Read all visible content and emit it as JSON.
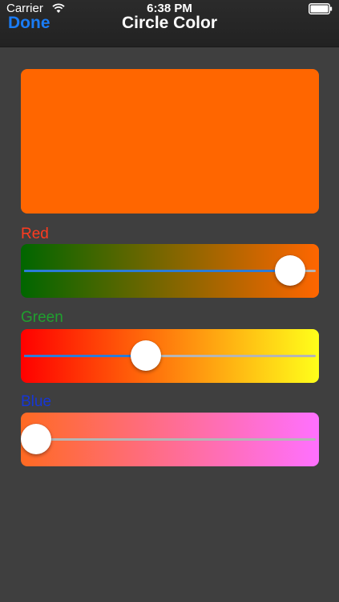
{
  "status_bar": {
    "carrier": "Carrier",
    "time": "6:38 PM",
    "wifi_icon": "wifi-icon",
    "battery_icon": "battery-icon"
  },
  "nav": {
    "done_label": "Done",
    "title": "Circle Color"
  },
  "colors": {
    "background": "#3f3f3f",
    "preview": "#ff6600",
    "done_text": "#1a7cf5",
    "red_label": "#ff3b1f",
    "green_label": "#1fa02e",
    "blue_label": "#1636d6",
    "slider_fill": "#2b7cd8"
  },
  "sliders": [
    {
      "key": "red",
      "label": "Red",
      "value_fraction": 0.95,
      "gradient_start": "#006600",
      "gradient_end": "#ff6600"
    },
    {
      "key": "green",
      "label": "Green",
      "value_fraction": 0.41,
      "gradient_start": "#ff0000",
      "gradient_end": "#ffff1a"
    },
    {
      "key": "blue",
      "label": "Blue",
      "value_fraction": 0.0,
      "gradient_start": "#ff6a22",
      "gradient_end": "#ff70ff"
    }
  ]
}
